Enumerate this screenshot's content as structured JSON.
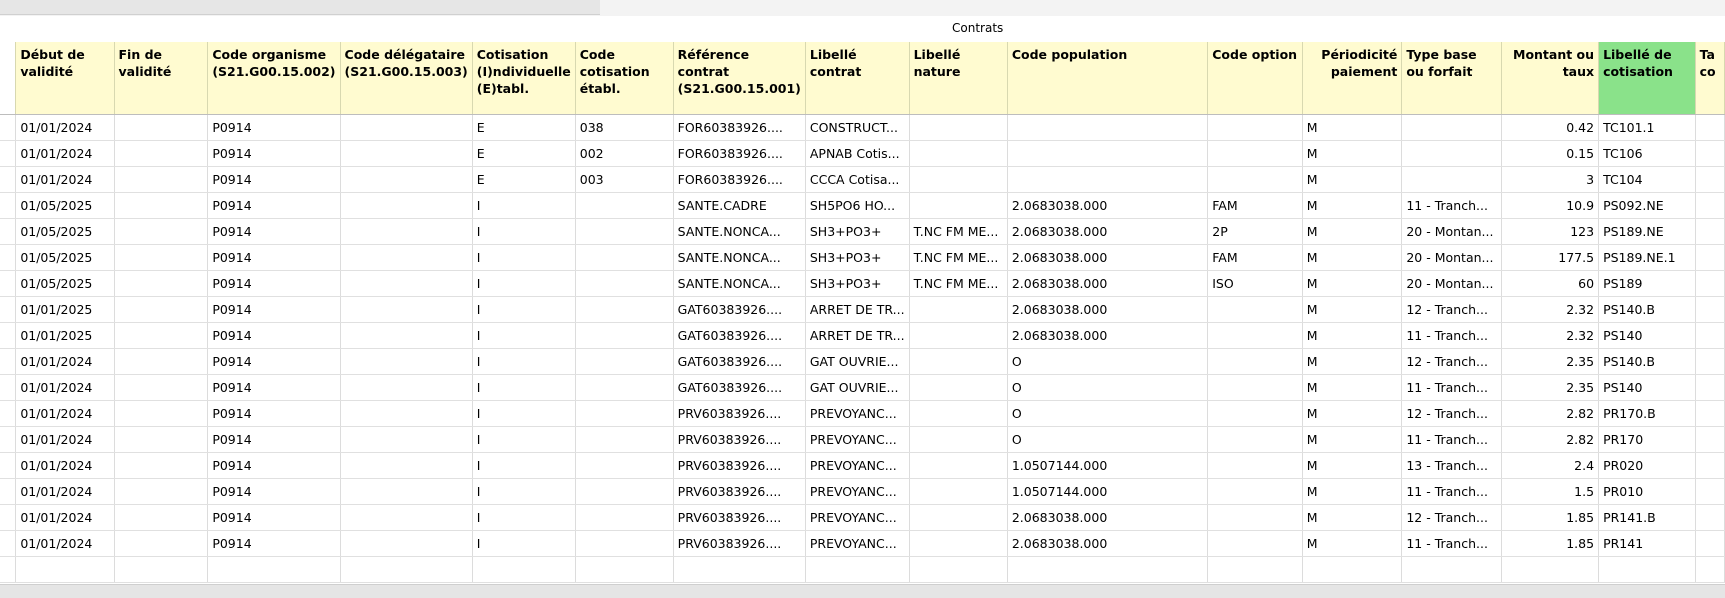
{
  "window": {
    "title": "Contrats"
  },
  "table": {
    "columns": [
      "",
      "Début de validité",
      "Fin de validité",
      "Code organisme (S21.G00.15.002)",
      "Code délégataire (S21.G00.15.003)",
      "Cotisation (I)ndividuelle (E)tabl.",
      "Code cotisation établ.",
      "Référence contrat (S21.G00.15.001)",
      "Libellé contrat",
      "Libellé nature",
      "Code population",
      "Code option",
      "Périodicité paiement",
      "Type base ou forfait",
      "Montant ou taux",
      "Libellé de cotisation",
      "Ta co"
    ],
    "rows": [
      [
        "",
        "01/01/2024",
        "",
        "P0914",
        "",
        "E",
        "038",
        "FOR60383926....",
        "CONSTRUCT...",
        "",
        "",
        "",
        "M",
        "",
        "0.42",
        "TC101.1",
        ""
      ],
      [
        "",
        "01/01/2024",
        "",
        "P0914",
        "",
        "E",
        "002",
        "FOR60383926....",
        "APNAB Cotis...",
        "",
        "",
        "",
        "M",
        "",
        "0.15",
        "TC106",
        ""
      ],
      [
        "",
        "01/01/2024",
        "",
        "P0914",
        "",
        "E",
        "003",
        "FOR60383926....",
        "CCCA Cotisa...",
        "",
        "",
        "",
        "M",
        "",
        "3",
        "TC104",
        ""
      ],
      [
        "",
        "01/05/2025",
        "",
        "P0914",
        "",
        "I",
        "",
        "SANTE.CADRE",
        "SH5PO6 HO...",
        "",
        "2.0683038.000",
        "FAM",
        "M",
        "11 - Tranch...",
        "10.9",
        "PS092.NE",
        ""
      ],
      [
        "",
        "01/05/2025",
        "",
        "P0914",
        "",
        "I",
        "",
        "SANTE.NONCA...",
        "SH3+PO3+",
        "T.NC FM ME...",
        "2.0683038.000",
        "2P",
        "M",
        "20 - Montan...",
        "123",
        "PS189.NE",
        ""
      ],
      [
        "",
        "01/05/2025",
        "",
        "P0914",
        "",
        "I",
        "",
        "SANTE.NONCA...",
        "SH3+PO3+",
        "T.NC FM ME...",
        "2.0683038.000",
        "FAM",
        "M",
        "20 - Montan...",
        "177.5",
        "PS189.NE.1",
        ""
      ],
      [
        "",
        "01/05/2025",
        "",
        "P0914",
        "",
        "I",
        "",
        "SANTE.NONCA...",
        "SH3+PO3+",
        "T.NC FM ME...",
        "2.0683038.000",
        "ISO",
        "M",
        "20 - Montan...",
        "60",
        "PS189",
        ""
      ],
      [
        "",
        "01/01/2025",
        "",
        "P0914",
        "",
        "I",
        "",
        "GAT60383926....",
        "ARRET DE TR...",
        "",
        "2.0683038.000",
        "",
        "M",
        "12 - Tranch...",
        "2.32",
        "PS140.B",
        ""
      ],
      [
        "",
        "01/01/2025",
        "",
        "P0914",
        "",
        "I",
        "",
        "GAT60383926....",
        "ARRET DE TR...",
        "",
        "2.0683038.000",
        "",
        "M",
        "11 - Tranch...",
        "2.32",
        "PS140",
        ""
      ],
      [
        "",
        "01/01/2024",
        "",
        "P0914",
        "",
        "I",
        "",
        "GAT60383926....",
        "GAT OUVRIE...",
        "",
        "O",
        "",
        "M",
        "12 - Tranch...",
        "2.35",
        "PS140.B",
        ""
      ],
      [
        "",
        "01/01/2024",
        "",
        "P0914",
        "",
        "I",
        "",
        "GAT60383926....",
        "GAT OUVRIE...",
        "",
        "O",
        "",
        "M",
        "11 - Tranch...",
        "2.35",
        "PS140",
        ""
      ],
      [
        "",
        "01/01/2024",
        "",
        "P0914",
        "",
        "I",
        "",
        "PRV60383926....",
        "PREVOYANC...",
        "",
        "O",
        "",
        "M",
        "12 - Tranch...",
        "2.82",
        "PR170.B",
        ""
      ],
      [
        "",
        "01/01/2024",
        "",
        "P0914",
        "",
        "I",
        "",
        "PRV60383926....",
        "PREVOYANC...",
        "",
        "O",
        "",
        "M",
        "11 - Tranch...",
        "2.82",
        "PR170",
        ""
      ],
      [
        "",
        "01/01/2024",
        "",
        "P0914",
        "",
        "I",
        "",
        "PRV60383926....",
        "PREVOYANC...",
        "",
        "1.0507144.000",
        "",
        "M",
        "13 - Tranch...",
        "2.4",
        "PR020",
        ""
      ],
      [
        "",
        "01/01/2024",
        "",
        "P0914",
        "",
        "I",
        "",
        "PRV60383926....",
        "PREVOYANC...",
        "",
        "1.0507144.000",
        "",
        "M",
        "11 - Tranch...",
        "1.5",
        "PR010",
        ""
      ],
      [
        "",
        "01/01/2024",
        "",
        "P0914",
        "",
        "I",
        "",
        "PRV60383926....",
        "PREVOYANC...",
        "",
        "2.0683038.000",
        "",
        "M",
        "12 - Tranch...",
        "1.85",
        "PR141.B",
        ""
      ],
      [
        "",
        "01/01/2024",
        "",
        "P0914",
        "",
        "I",
        "",
        "PRV60383926....",
        "PREVOYANC...",
        "",
        "2.0683038.000",
        "",
        "M",
        "11 - Tranch...",
        "1.85",
        "PR141",
        ""
      ],
      [
        "",
        "",
        "",
        "",
        "",
        "",
        "",
        "",
        "",
        "",
        "",
        "",
        "",
        "",
        "",
        "",
        ""
      ]
    ]
  }
}
